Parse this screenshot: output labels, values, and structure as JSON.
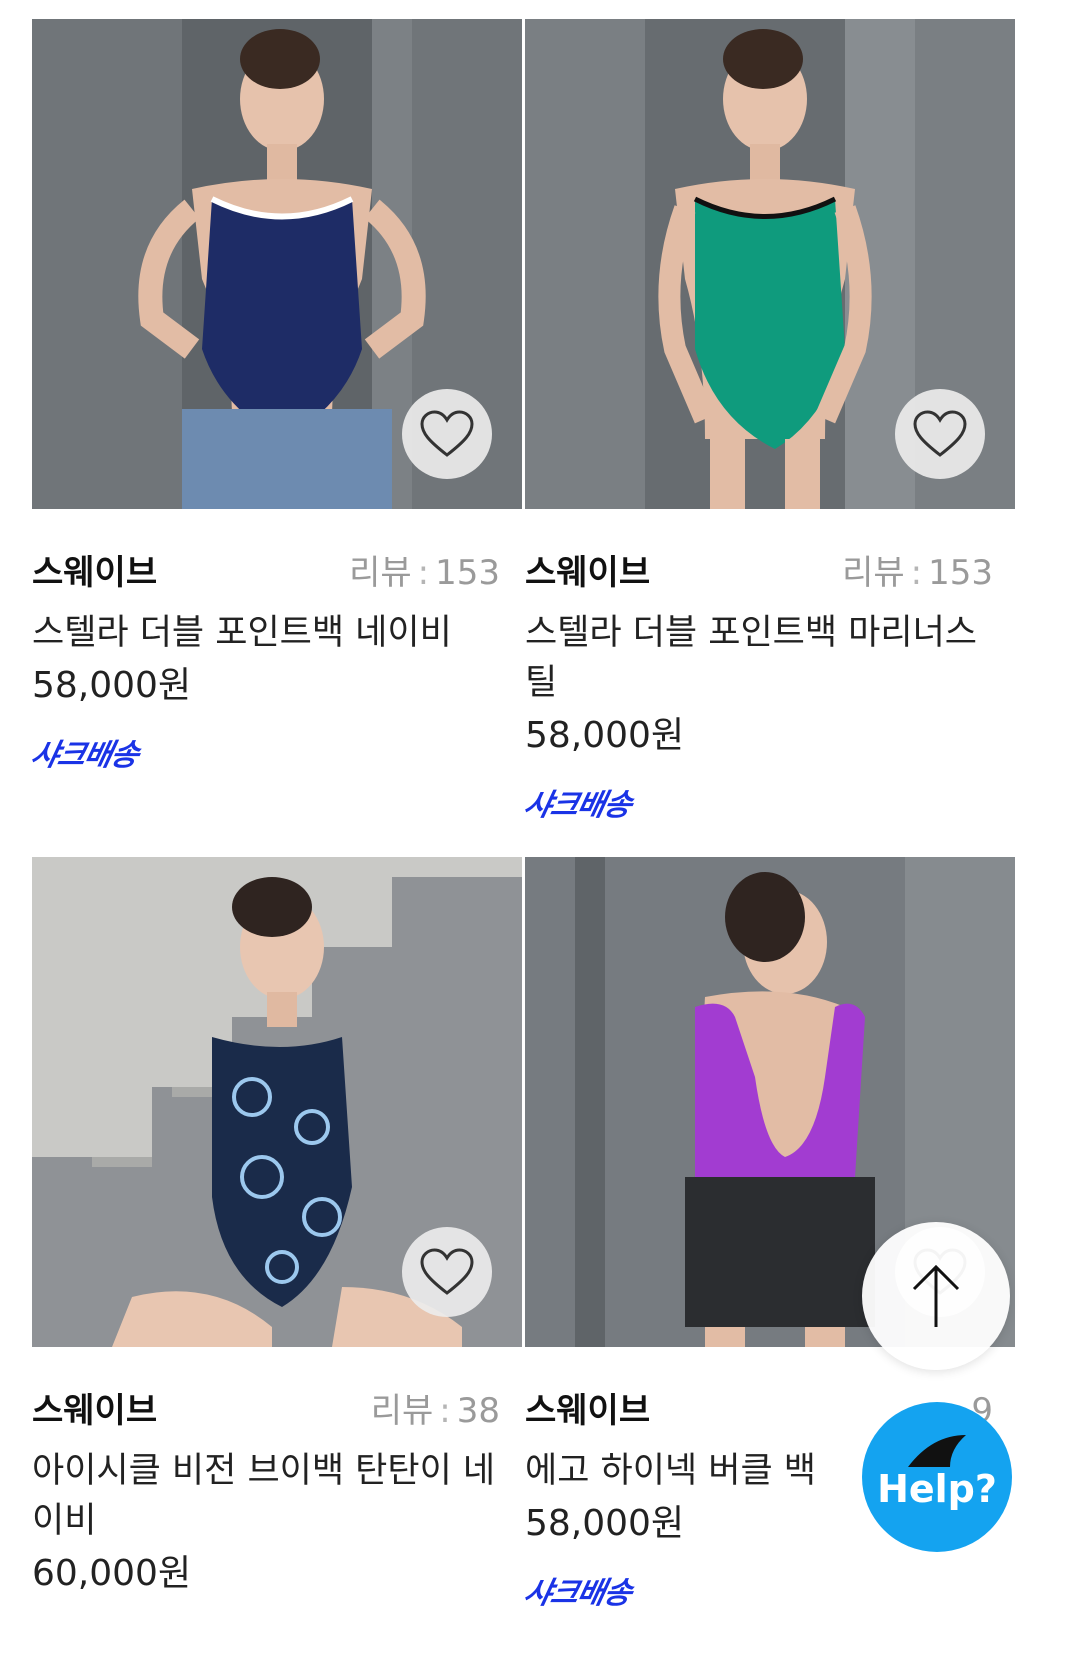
{
  "products": [
    {
      "brand": "스웨이브",
      "review_label": "리뷰",
      "review_count": "153",
      "name": "스텔라 더블 포인트백 네이비",
      "price": "58,000원",
      "shipping_badge": "샤크배송",
      "wishlisted": false
    },
    {
      "brand": "스웨이브",
      "review_label": "리뷰",
      "review_count": "153",
      "name": "스텔라 더블 포인트백 마리너스 틸",
      "price": "58,000원",
      "shipping_badge": "샤크배송",
      "wishlisted": false
    },
    {
      "brand": "스웨이브",
      "review_label": "리뷰",
      "review_count": "38",
      "name": "아이시클 비전 브이백 탄탄이 네이비",
      "price": "60,000원",
      "shipping_badge": "",
      "wishlisted": false
    },
    {
      "brand": "스웨이브",
      "review_label": "",
      "review_count": "9",
      "name": "에고 하이넥 버클 백",
      "price": "58,000원",
      "shipping_badge": "샤크배송",
      "wishlisted": false
    }
  ],
  "floating": {
    "scroll_top_icon": "arrow-up-icon",
    "help_label": "Help?",
    "help_icon": "shark-fin-icon"
  },
  "colors": {
    "shipping_badge": "#1a33e6",
    "help_button": "#14a3f0",
    "review_text": "#9a9a9a"
  }
}
